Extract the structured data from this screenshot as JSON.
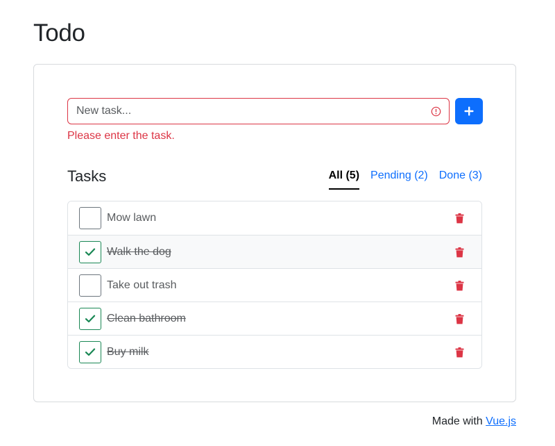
{
  "page": {
    "title": "Todo"
  },
  "form": {
    "placeholder": "New task...",
    "value": "",
    "error": "Please enter the task.",
    "add_icon": "plus-icon",
    "invalid_icon": "exclamation-circle-icon"
  },
  "tasks_section": {
    "title": "Tasks",
    "tabs": [
      {
        "label": "All (5)",
        "active": true
      },
      {
        "label": "Pending (2)",
        "active": false
      },
      {
        "label": "Done (3)",
        "active": false
      }
    ],
    "items": [
      {
        "label": "Mow lawn",
        "done": false
      },
      {
        "label": "Walk the dog",
        "done": true
      },
      {
        "label": "Take out trash",
        "done": false
      },
      {
        "label": "Clean bathroom",
        "done": true
      },
      {
        "label": "Buy milk",
        "done": true
      }
    ]
  },
  "footer": {
    "prefix": "Made with",
    "link": "Vue.js"
  },
  "colors": {
    "primary": "#0d6efd",
    "danger": "#dc3545",
    "success": "#198754",
    "muted_text": "#595c5f"
  }
}
